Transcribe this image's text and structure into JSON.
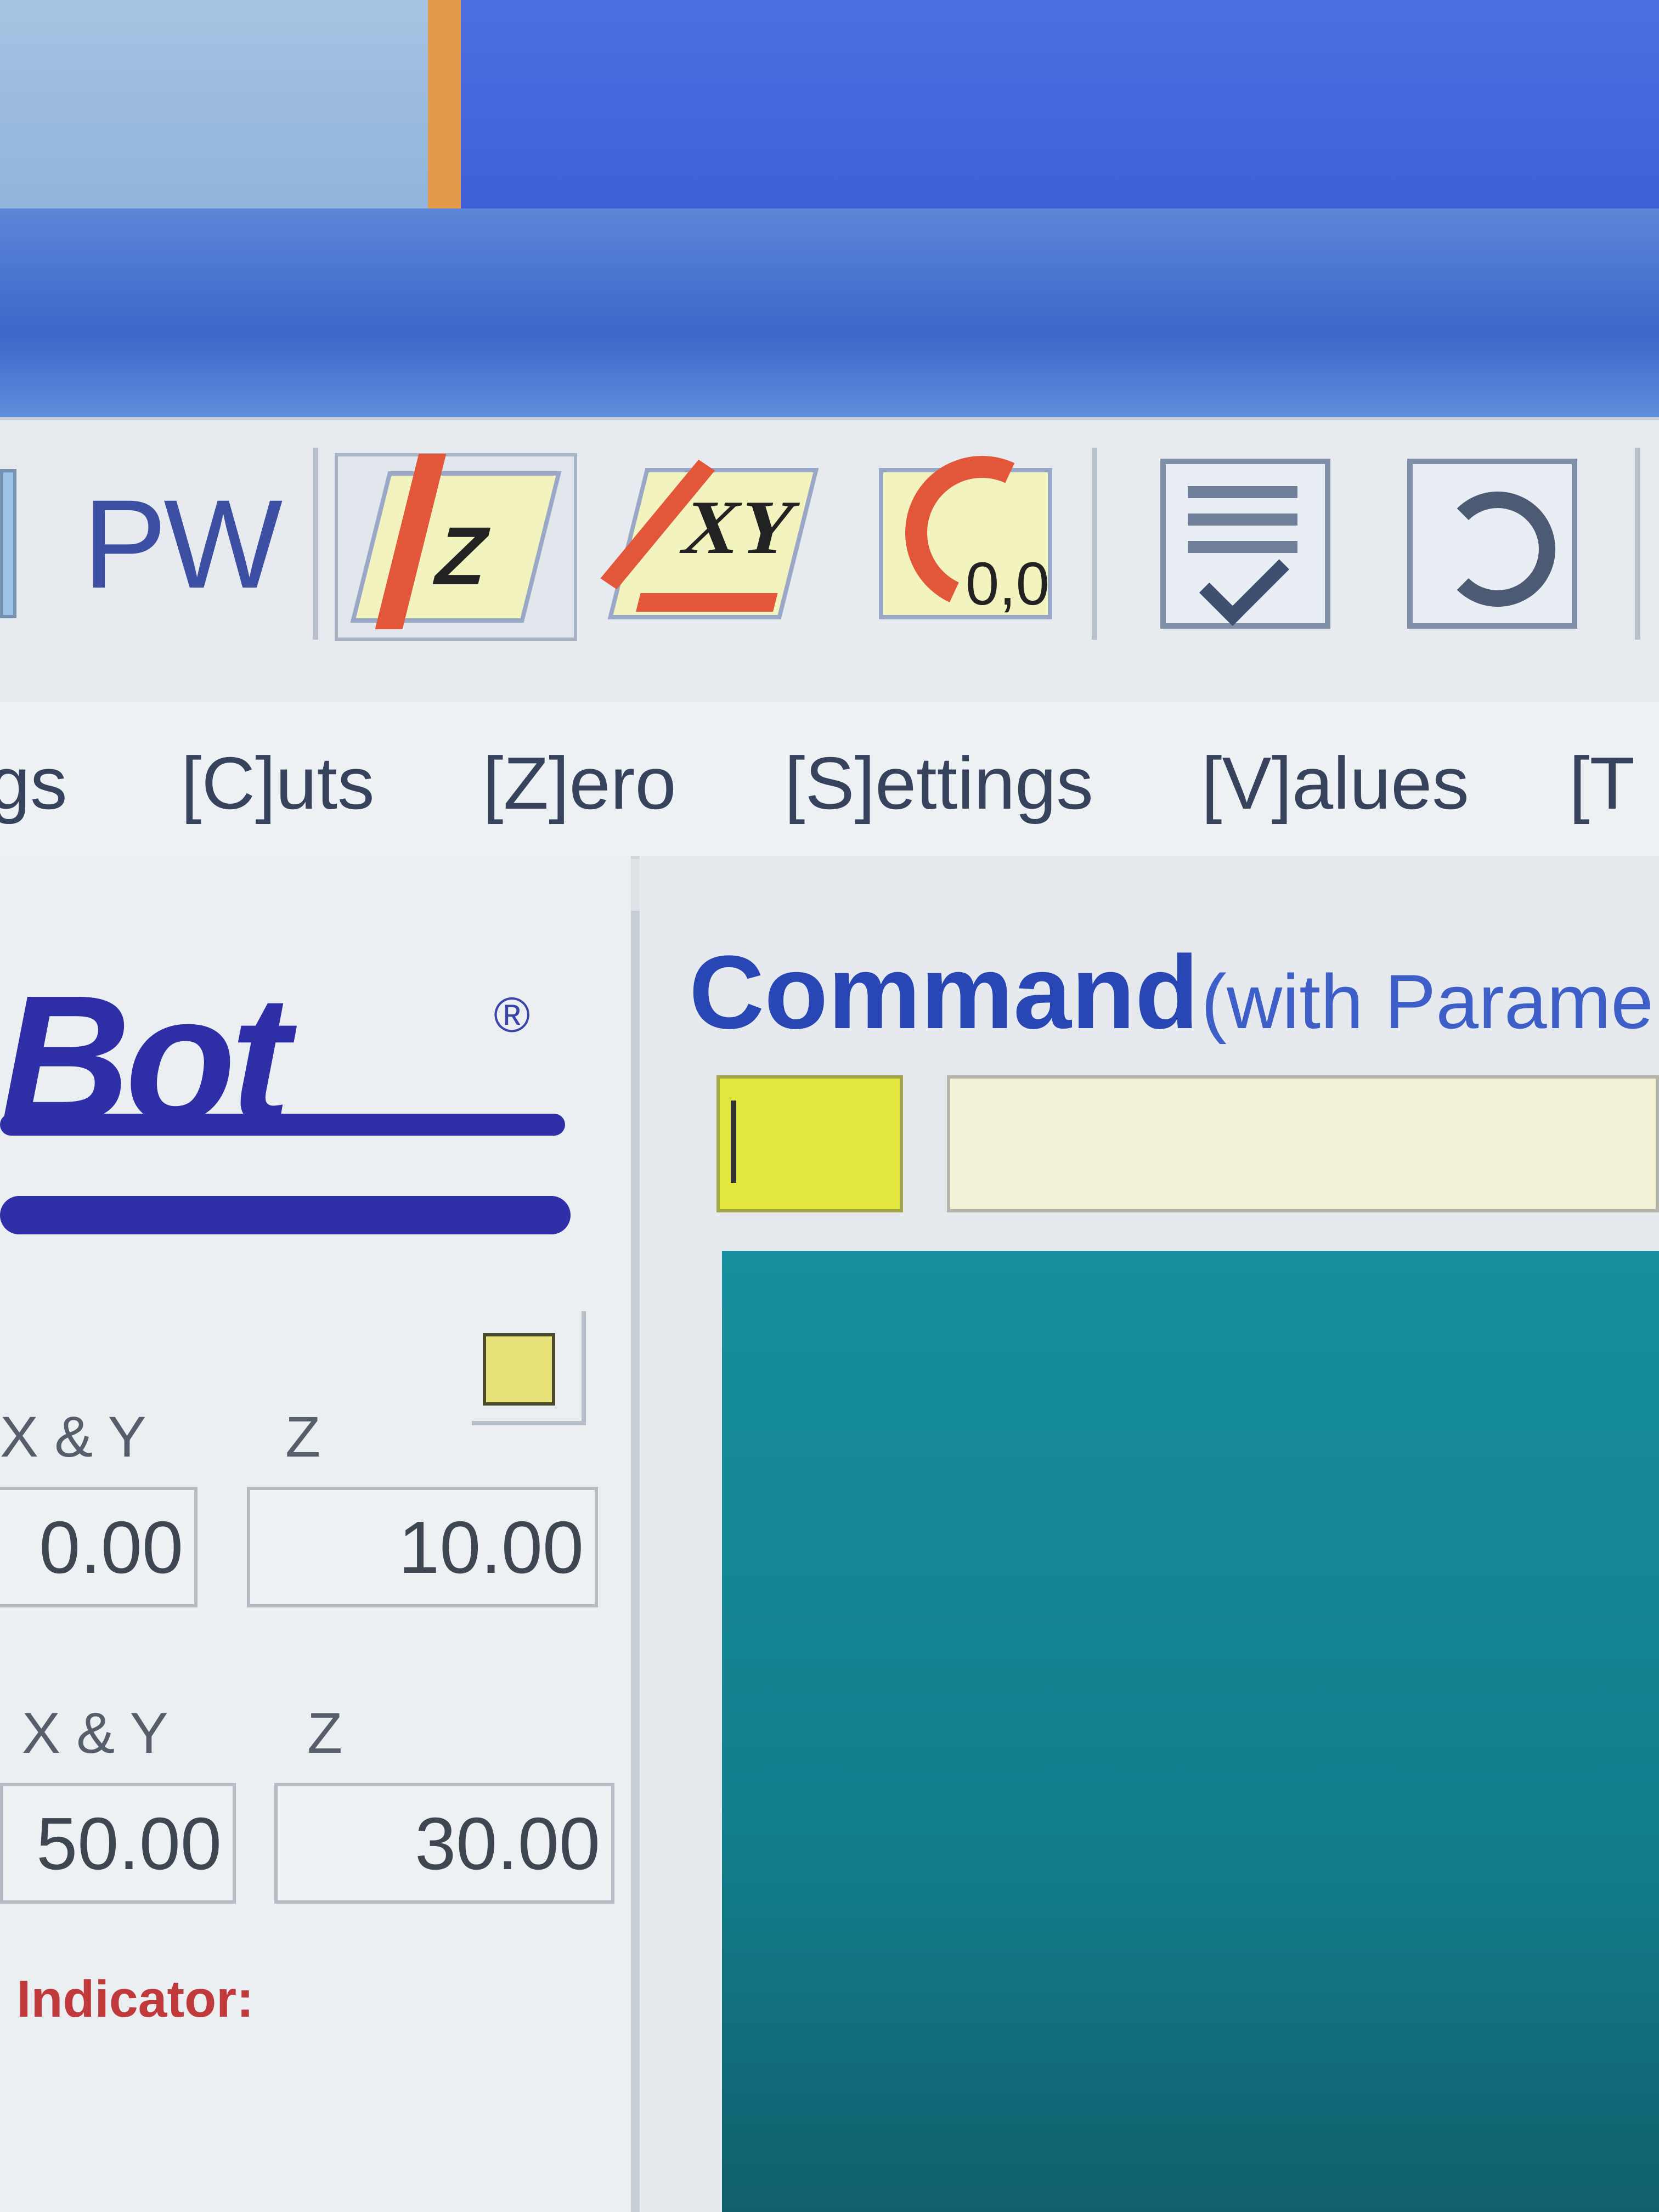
{
  "toolbar": {
    "pw_label": "PW",
    "z_icon_label": "Z",
    "xy_icon_label": "XY",
    "zero_icon_label": "0,0"
  },
  "menu": {
    "items": [
      {
        "label": "gs"
      },
      {
        "label": "[C]uts"
      },
      {
        "label": "[Z]ero"
      },
      {
        "label": "[S]ettings"
      },
      {
        "label": "[V]alues"
      },
      {
        "label": "[T"
      }
    ]
  },
  "logo": {
    "text": "Bot",
    "reg": "®"
  },
  "jog": {
    "row1": {
      "xy_label": "X & Y",
      "z_label": "Z",
      "xy_value": "0.00",
      "z_value": "10.00"
    },
    "row2": {
      "xy_label": "X & Y",
      "z_label": "Z",
      "xy_value": "50.00",
      "z_value": "30.00"
    },
    "indicator_label": "Indicator:"
  },
  "command": {
    "title": "Command",
    "subtitle": "(with Parame"
  },
  "colors": {
    "accent_blue": "#2846b4",
    "key_yellow": "#e4e640",
    "output_teal": "#168e9d",
    "indicator_red": "#c0393b"
  }
}
